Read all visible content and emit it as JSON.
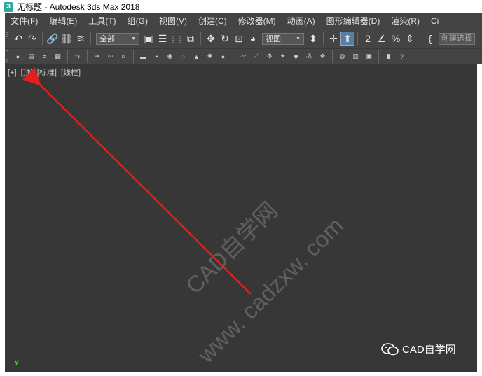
{
  "window": {
    "title": "无标题 - Autodesk 3ds Max 2018",
    "logo_text": "3"
  },
  "menu": {
    "items": [
      "文件(F)",
      "编辑(E)",
      "工具(T)",
      "组(G)",
      "视图(V)",
      "创建(C)",
      "修改器(M)",
      "动画(A)",
      "图形编辑器(D)",
      "渲染(R)",
      "Ci"
    ]
  },
  "toolbar": {
    "selection_filter": "全部",
    "reference_coord": "视图",
    "named_selection_placeholder": "创建选择"
  },
  "viewport": {
    "label_plus": "[+]",
    "label_view": "[顶]",
    "label_shading": "[标准]",
    "label_mode": "[线框]",
    "axis_label": "y",
    "arrow_color": "#e02020"
  },
  "watermark": {
    "line1": "CAD自学网",
    "line2": "www. cadzxw. com"
  },
  "brand": {
    "icon": "wechat-icon",
    "text": "CAD自学网"
  }
}
